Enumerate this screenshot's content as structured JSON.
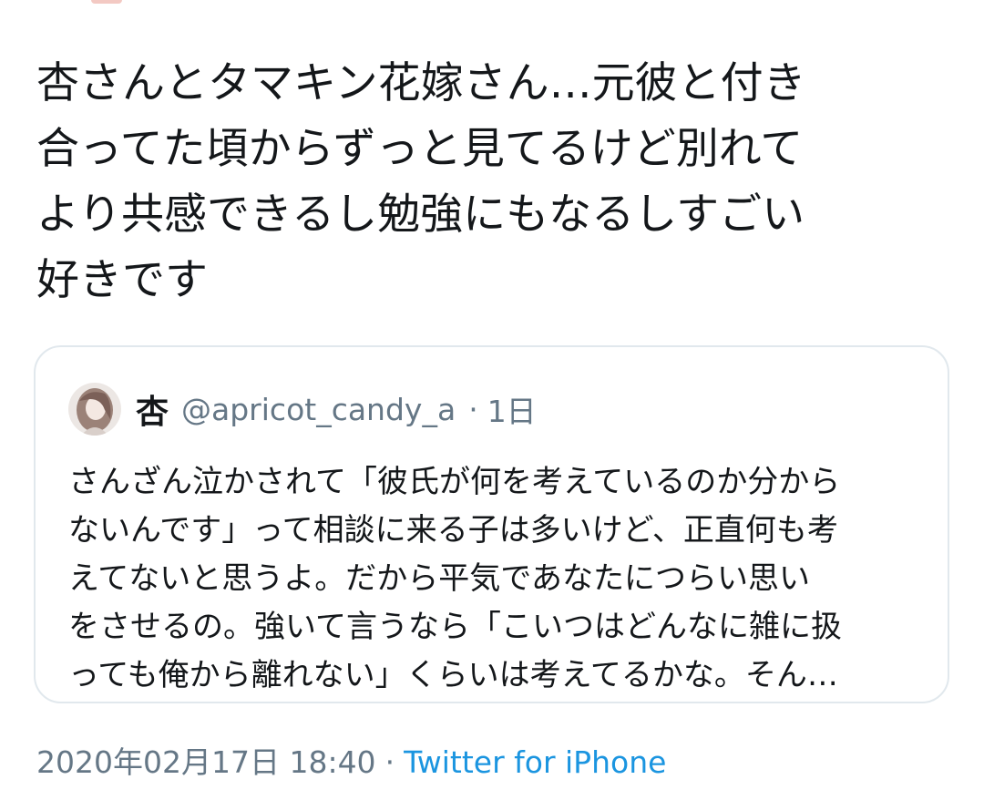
{
  "tweet": {
    "text": "杏さんとタマキン花嫁さん…元彼と付き\n合ってた頃からずっと見てるけど別れて\nより共感できるし勉強にもなるしすごい\n好きです"
  },
  "quote": {
    "avatar_icon": "user-avatar-illustration",
    "name": "杏",
    "handle": "@apricot_candy_a",
    "separator": "·",
    "time": "1日",
    "text": "さんざん泣かされて「彼氏が何を考えているのか分から\nないんです」って相談に来る子は多いけど、正直何も考\nえてないと思うよ。だから平気であなたにつらい思い\nをさせるの。強いて言うなら「こいつはどんなに雑に扱\nっても俺から離れない」くらいは考えてるかな。そん…"
  },
  "meta": {
    "timestamp": "2020年02月17日 18:40",
    "separator": "·",
    "source": "Twitter for iPhone"
  },
  "colors": {
    "text": "#14171a",
    "secondary": "#657786",
    "link": "#1b95e0",
    "border": "#e1e8ed"
  }
}
